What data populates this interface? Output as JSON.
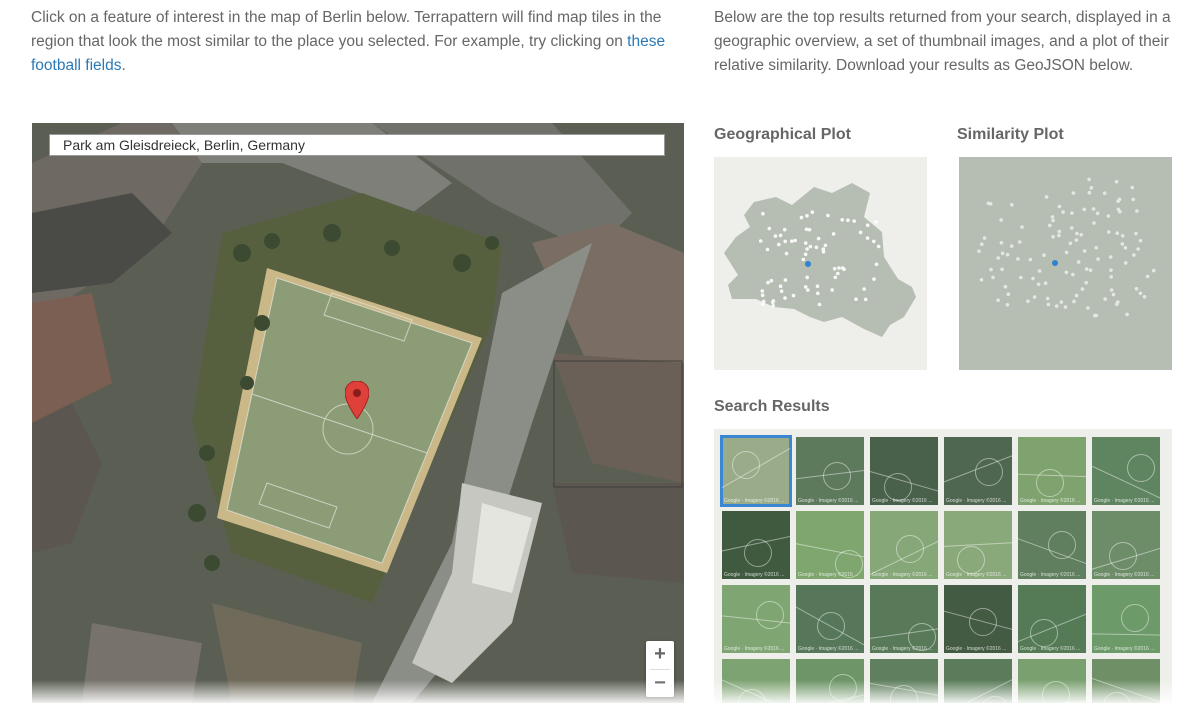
{
  "intro": {
    "left_text": "Click on a feature of interest in the map of Berlin below. Terrapattern will find map tiles in the region that look the most similar to the place you selected. For example, try clicking on ",
    "left_link": "these football fields",
    "left_end": ".",
    "right_text": "Below are the top results returned from your search, displayed in a geographic overview, a set of thumbnail images, and a plot of their relative similarity. Download your results as GeoJSON below."
  },
  "map": {
    "search_value": "Park am Gleisdreieck, Berlin, Germany",
    "zoom_in": "+",
    "zoom_out": "−"
  },
  "plots": {
    "geo_title": "Geographical Plot",
    "sim_title": "Similarity Plot"
  },
  "results": {
    "title": "Search Results",
    "thumb_credit": "Google · Imagery ©2016 ...",
    "thumbnails": [
      {
        "color": "#9aab8a",
        "selected": true
      },
      {
        "color": "#5d7a5c"
      },
      {
        "color": "#49604a"
      },
      {
        "color": "#4f6650"
      },
      {
        "color": "#7fa36e"
      },
      {
        "color": "#5f8560"
      },
      {
        "color": "#3f5a3e"
      },
      {
        "color": "#7ea66e"
      },
      {
        "color": "#86a778"
      },
      {
        "color": "#8aa97a"
      },
      {
        "color": "#5f7f5e"
      },
      {
        "color": "#6d8d69"
      },
      {
        "color": "#7fa672"
      },
      {
        "color": "#56775a"
      },
      {
        "color": "#587a59"
      },
      {
        "color": "#435a43"
      },
      {
        "color": "#547a56"
      },
      {
        "color": "#6c9a68"
      },
      {
        "color": "#7ea372"
      },
      {
        "color": "#6e9568"
      },
      {
        "color": "#5f7f5e"
      },
      {
        "color": "#5a7c5a"
      },
      {
        "color": "#7aa070"
      },
      {
        "color": "#6f9066"
      }
    ]
  },
  "colors": {
    "link": "#2a78b5",
    "selected_outline": "#3a88d4",
    "query_point": "#2d83cf",
    "berlin_shape": "#b6beb4",
    "plot_bg": "#eeeeea"
  }
}
